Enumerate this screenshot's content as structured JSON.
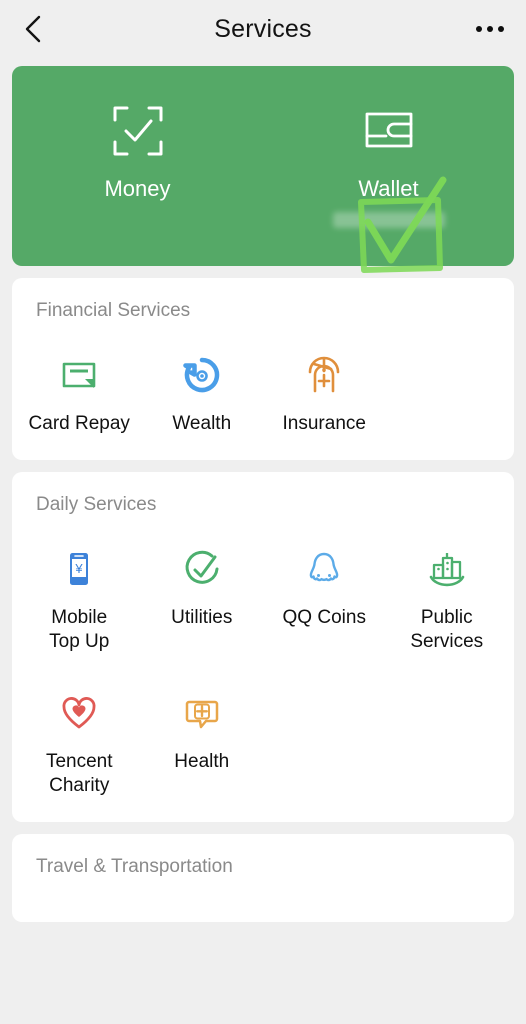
{
  "nav": {
    "back_icon": "chevron-left-icon",
    "title": "Services",
    "more_icon": "more-options-icon"
  },
  "hero": {
    "background_color": "#55a967",
    "items": [
      {
        "icon": "scan-check-icon",
        "label": "Money",
        "subtitle": ""
      },
      {
        "icon": "wallet-icon",
        "label": "Wallet",
        "subtitle": " "
      }
    ],
    "annotation": {
      "type": "handdrawn-check-and-box",
      "color": "#7ed957",
      "target": "Wallet"
    }
  },
  "sections": [
    {
      "title": "Financial Services",
      "items": [
        {
          "icon": "card-repay-icon",
          "label": "Card Repay",
          "color": "#4caf6e"
        },
        {
          "icon": "wealth-icon",
          "label": "Wealth",
          "color": "#4a9ee8"
        },
        {
          "icon": "insurance-icon",
          "label": "Insurance",
          "color": "#e08f3c"
        }
      ]
    },
    {
      "title": "Daily Services",
      "items": [
        {
          "icon": "mobile-topup-icon",
          "label": "Mobile\nTop Up",
          "color": "#3d82d9"
        },
        {
          "icon": "utilities-icon",
          "label": "Utilities",
          "color": "#4caf6e"
        },
        {
          "icon": "qq-coins-icon",
          "label": "QQ Coins",
          "color": "#5cabe8"
        },
        {
          "icon": "public-services-icon",
          "label": "Public\nServices",
          "color": "#4caf6e"
        },
        {
          "icon": "tencent-charity-icon",
          "label": "Tencent\nCharity",
          "color": "#e05a55"
        },
        {
          "icon": "health-icon",
          "label": "Health",
          "color": "#e8a64a"
        }
      ]
    },
    {
      "title": "Travel & Transportation",
      "items": []
    }
  ]
}
